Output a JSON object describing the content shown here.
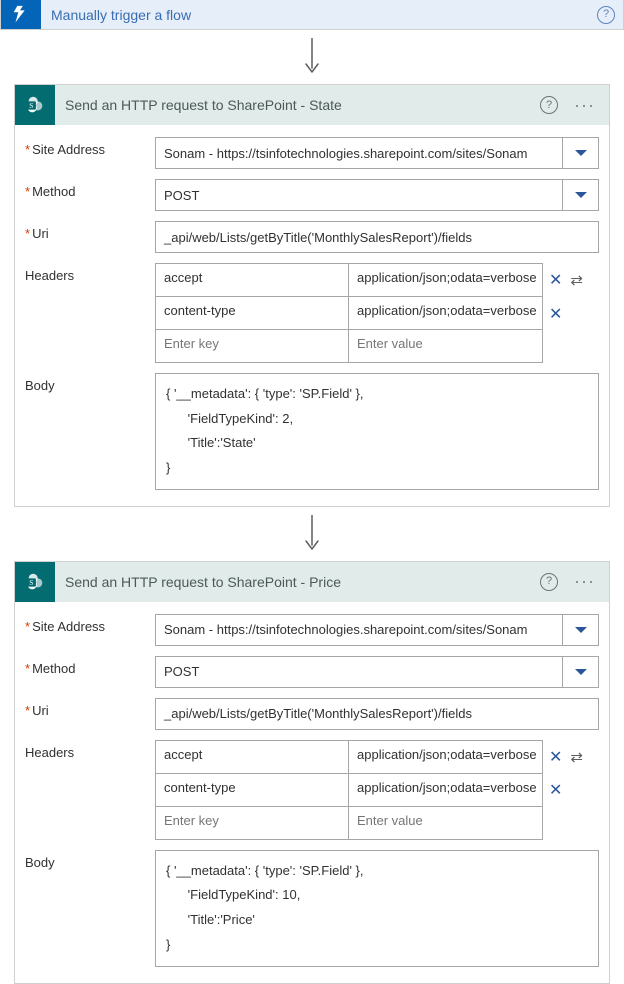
{
  "trigger": {
    "title": "Manually trigger a flow"
  },
  "card1": {
    "title": "Send an HTTP request to SharePoint - State",
    "labels": {
      "siteAddress": "Site Address",
      "method": "Method",
      "uri": "Uri",
      "headers": "Headers",
      "body": "Body"
    },
    "siteAddress": "Sonam - https://tsinfotechnologies.sharepoint.com/sites/Sonam",
    "method": "POST",
    "uri": "_api/web/Lists/getByTitle('MonthlySalesReport')/fields",
    "headers": [
      {
        "key": "accept",
        "value": "application/json;odata=verbose"
      },
      {
        "key": "content-type",
        "value": "application/json;odata=verbose"
      }
    ],
    "headerKeyPlaceholder": "Enter key",
    "headerValPlaceholder": "Enter value",
    "body": "{ '__metadata': { 'type': 'SP.Field' },\n      'FieldTypeKind': 2,\n      'Title':'State'\n}"
  },
  "card2": {
    "title": "Send an HTTP request to SharePoint - Price",
    "labels": {
      "siteAddress": "Site Address",
      "method": "Method",
      "uri": "Uri",
      "headers": "Headers",
      "body": "Body"
    },
    "siteAddress": "Sonam - https://tsinfotechnologies.sharepoint.com/sites/Sonam",
    "method": "POST",
    "uri": "_api/web/Lists/getByTitle('MonthlySalesReport')/fields",
    "headers": [
      {
        "key": "accept",
        "value": "application/json;odata=verbose"
      },
      {
        "key": "content-type",
        "value": "application/json;odata=verbose"
      }
    ],
    "headerKeyPlaceholder": "Enter key",
    "headerValPlaceholder": "Enter value",
    "body": "{ '__metadata': { 'type': 'SP.Field' },\n      'FieldTypeKind': 10,\n      'Title':'Price'\n}"
  },
  "icons": {
    "help": "?",
    "more": "···",
    "close": "✕",
    "switch": "⇄"
  }
}
